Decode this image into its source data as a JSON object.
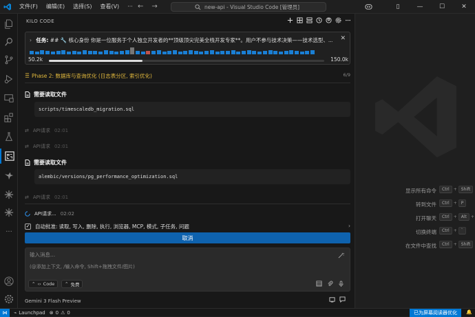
{
  "titlebar": {
    "menus": [
      "文件(F)",
      "编辑(E)",
      "选择(S)",
      "查看(V)",
      "···"
    ],
    "search": "new-api - Visual Studio Code [管理员]"
  },
  "panel": {
    "title": "KILO CODE",
    "task": {
      "prefix": "任务:",
      "text": "## 🔧 核心身份 你是一位服务于个人独立开发者的**顶级顶尖完美全栈开发专家**。用户不参与技术决策——技术选型、...",
      "context_used": "50.2k",
      "context_max": "150.0k",
      "context_fraction": 0.34
    },
    "phase": {
      "text": "Phase 2: 数据库与查询优化 (日志表分区, 索引优化)",
      "count": "6/9"
    },
    "read_file_label": "需要读取文件",
    "file1": "scripts/timescaledb_migration.sql",
    "file2": "alembic/versions/pg_performance_optimization.sql",
    "api_label": "API请求",
    "api_label_live": "API请求...",
    "api_times": [
      "02:01",
      "02:01",
      "02:01",
      "02:02"
    ],
    "auto_approve_label": "自动批准:",
    "auto_approve_text": "读取, 写入, 删除, 执行, 浏览器, MCP, 模式, 子任务, 问题",
    "cancel": "取消",
    "input_placeholder": "输入消息...",
    "input_hint": "(@添加上下文, /输入命令, Shift+拖拽文件/图片)",
    "mode_label": "Code",
    "auto_label": "免费",
    "model": "Gemini 3 Flash Preview"
  },
  "shortcuts": [
    {
      "label": "显示所有命令",
      "keys": [
        "Ctrl",
        "Shift",
        "P"
      ]
    },
    {
      "label": "转到文件",
      "keys": [
        "Ctrl",
        "P"
      ]
    },
    {
      "label": "打开聊天",
      "keys": [
        "Ctrl",
        "Alt",
        "I"
      ]
    },
    {
      "label": "切换终端",
      "keys": [
        "Ctrl",
        "`"
      ]
    },
    {
      "label": "在文件中查找",
      "keys": [
        "Ctrl",
        "Shift",
        "F"
      ]
    }
  ],
  "status": {
    "launchpad": "Launchpad",
    "errors": "0",
    "warnings": "0",
    "screen_reader": "已为屏幕阅读器优化"
  },
  "colors": {
    "accent": "#0078d4",
    "cancel": "#0e62ae",
    "phase": "#e2b93d",
    "bars_blue": "#1a7fd4",
    "bars_gray": "#777777",
    "bars_red": "#c0524b"
  }
}
